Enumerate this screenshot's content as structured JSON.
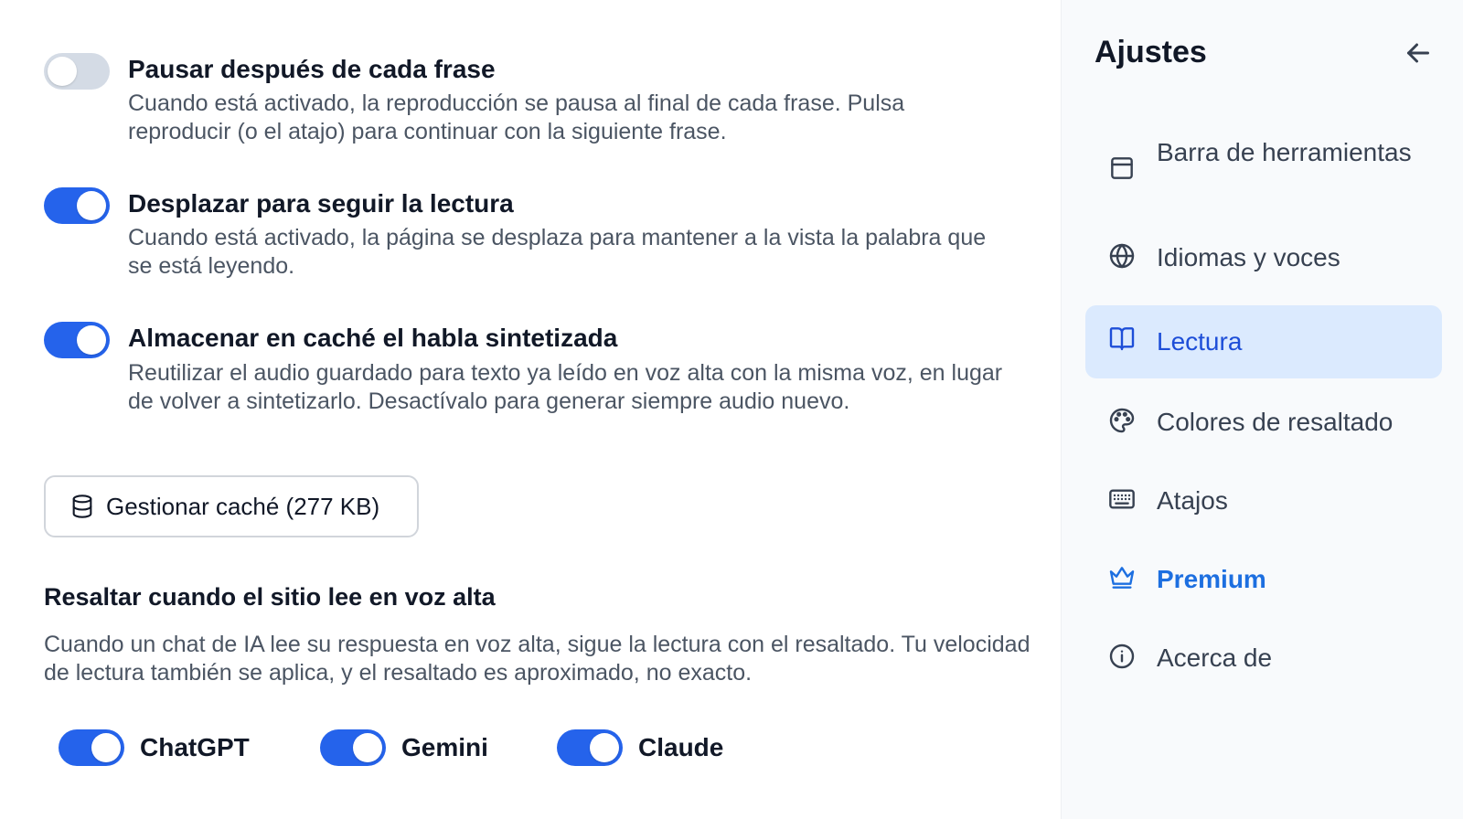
{
  "settings": [
    {
      "title": "Pausar después de cada frase",
      "description": "Cuando está activado, la reproducción se pausa al final de cada frase. Pulsa reproducir (o el atajo) para continuar con la siguiente frase.",
      "enabled": false
    },
    {
      "title": "Desplazar para seguir la lectura",
      "description": "Cuando está activado, la página se desplaza para mantener a la vista la palabra que se está leyendo.",
      "enabled": true
    },
    {
      "title": "Almacenar en caché el habla sintetizada",
      "description": "Reutilizar el audio guardado para texto ya leído en voz alta con la misma voz, en lugar de volver a sintetizarlo. Desactívalo para generar siempre audio nuevo.",
      "enabled": true
    }
  ],
  "cache_button": {
    "label": "Gestionar caché (277 KB)",
    "icon": "database-icon"
  },
  "highlight_section": {
    "title": "Resaltar cuando el sitio lee en voz alta",
    "description": "Cuando un chat de IA lee su respuesta en voz alta, sigue la lectura con el resaltado. Tu velocidad de lectura también se aplica, y el resaltado es aproximado, no exacto.",
    "sites": [
      {
        "label": "ChatGPT",
        "enabled": true
      },
      {
        "label": "Gemini",
        "enabled": true
      },
      {
        "label": "Claude",
        "enabled": true
      }
    ]
  },
  "sidebar": {
    "title": "Ajustes",
    "back_icon": "arrow-left-icon",
    "items": [
      {
        "label": "Barra de herramientas",
        "icon": "toolbar-icon",
        "active": false
      },
      {
        "label": "Idiomas y voces",
        "icon": "globe-icon",
        "active": false
      },
      {
        "label": "Lectura",
        "icon": "book-icon",
        "active": true
      },
      {
        "label": "Colores de resaltado",
        "icon": "palette-icon",
        "active": false
      },
      {
        "label": "Atajos",
        "icon": "keyboard-icon",
        "active": false
      },
      {
        "label": "Premium",
        "icon": "crown-icon",
        "active": false
      },
      {
        "label": "Acerca de",
        "icon": "info-icon",
        "active": false
      }
    ]
  },
  "colors": {
    "accent": "#2563eb",
    "active_nav_bg": "#dbeafe",
    "toggle_off": "#d4dbe5"
  }
}
